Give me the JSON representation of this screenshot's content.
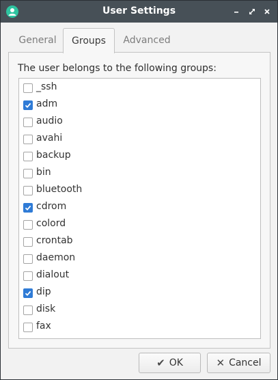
{
  "window": {
    "title": "User Settings",
    "icon": "user-icon",
    "controls": [
      "minimize",
      "maximize",
      "close"
    ]
  },
  "tabs": [
    {
      "label": "General",
      "active": false
    },
    {
      "label": "Groups",
      "active": true
    },
    {
      "label": "Advanced",
      "active": false
    }
  ],
  "groups_panel": {
    "description": "The user belongs to the following groups:",
    "items": [
      {
        "label": "_ssh",
        "checked": false
      },
      {
        "label": "adm",
        "checked": true
      },
      {
        "label": "audio",
        "checked": false
      },
      {
        "label": "avahi",
        "checked": false
      },
      {
        "label": "backup",
        "checked": false
      },
      {
        "label": "bin",
        "checked": false
      },
      {
        "label": "bluetooth",
        "checked": false
      },
      {
        "label": "cdrom",
        "checked": true
      },
      {
        "label": "colord",
        "checked": false
      },
      {
        "label": "crontab",
        "checked": false
      },
      {
        "label": "daemon",
        "checked": false
      },
      {
        "label": "dialout",
        "checked": false
      },
      {
        "label": "dip",
        "checked": true
      },
      {
        "label": "disk",
        "checked": false
      },
      {
        "label": "fax",
        "checked": false
      }
    ]
  },
  "buttons": {
    "ok_label": "OK",
    "ok_icon": "checkmark-icon",
    "cancel_label": "Cancel",
    "cancel_icon": "x-icon"
  },
  "colors": {
    "titlebar": "#475057",
    "accent": "#2f7bd6",
    "app_icon": "#2ec4a0"
  }
}
